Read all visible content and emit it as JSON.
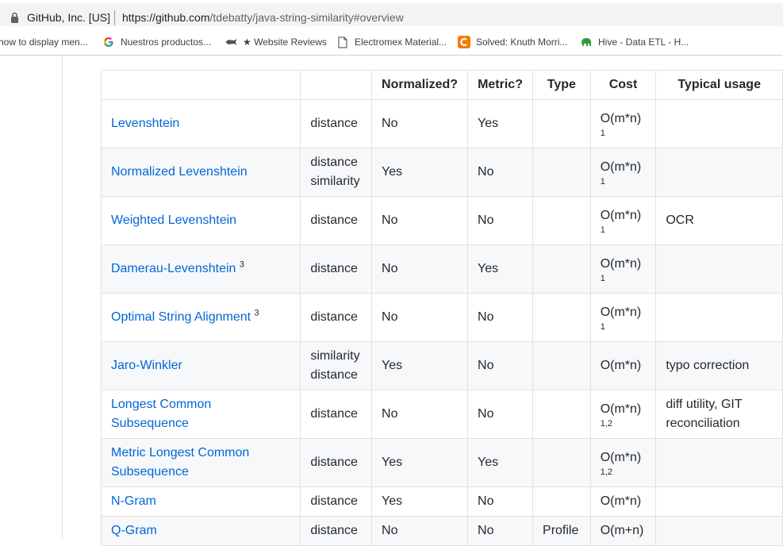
{
  "browser": {
    "site_name": "GitHub, Inc. [US]",
    "url_host": "https://github.com",
    "url_path": "/tdebatty/java-string-similarity#overview"
  },
  "bookmarks": [
    {
      "label": "how to display men...",
      "icon": "page-icon"
    },
    {
      "label": "Nuestros productos...",
      "icon": "google-icon"
    },
    {
      "label": "★ Website Reviews",
      "icon": "fish-icon"
    },
    {
      "label": "Electromex Material...",
      "icon": "document-icon"
    },
    {
      "label": "Solved: Knuth Morri...",
      "icon": "c-logo-icon"
    },
    {
      "label": "Hive - Data ETL - H...",
      "icon": "elephant-icon"
    }
  ],
  "colors": {
    "link": "#0366d6",
    "text": "#24292e",
    "border": "#dfe2e5",
    "stripe": "#f6f8fa"
  },
  "table": {
    "headers": [
      "",
      "",
      "Normalized?",
      "Metric?",
      "Type",
      "Cost",
      "Typical usage"
    ],
    "rows": [
      {
        "name": "Levenshtein",
        "sup": "",
        "kind": "distance",
        "normalized": "No",
        "metric": "Yes",
        "type": "",
        "cost": "O(m*n)",
        "cost_note": "1",
        "usage": ""
      },
      {
        "name": "Normalized Levenshtein",
        "sup": "",
        "kind": "distance similarity",
        "normalized": "Yes",
        "metric": "No",
        "type": "",
        "cost": "O(m*n)",
        "cost_note": "1",
        "usage": ""
      },
      {
        "name": "Weighted Levenshtein",
        "sup": "",
        "kind": "distance",
        "normalized": "No",
        "metric": "No",
        "type": "",
        "cost": "O(m*n)",
        "cost_note": "1",
        "usage": "OCR"
      },
      {
        "name": "Damerau-Levenshtein",
        "sup": "3",
        "kind": "distance",
        "normalized": "No",
        "metric": "Yes",
        "type": "",
        "cost": "O(m*n)",
        "cost_note": "1",
        "usage": ""
      },
      {
        "name": "Optimal String Alignment",
        "sup": "3",
        "kind": "distance",
        "normalized": "No",
        "metric": "No",
        "type": "",
        "cost": "O(m*n)",
        "cost_note": "1",
        "usage": ""
      },
      {
        "name": "Jaro-Winkler",
        "sup": "",
        "kind": "similarity distance",
        "normalized": "Yes",
        "metric": "No",
        "type": "",
        "cost": "O(m*n)",
        "cost_note": "",
        "usage": "typo correction"
      },
      {
        "name": "Longest Common Subsequence",
        "sup": "",
        "kind": "distance",
        "normalized": "No",
        "metric": "No",
        "type": "",
        "cost": "O(m*n)",
        "cost_note": "1,2",
        "usage": "diff utility, GIT reconciliation"
      },
      {
        "name": "Metric Longest Common Subsequence",
        "sup": "",
        "kind": "distance",
        "normalized": "Yes",
        "metric": "Yes",
        "type": "",
        "cost": "O(m*n)",
        "cost_note": "1,2",
        "usage": ""
      },
      {
        "name": "N-Gram",
        "sup": "",
        "kind": "distance",
        "normalized": "Yes",
        "metric": "No",
        "type": "",
        "cost": "O(m*n)",
        "cost_note": "",
        "usage": ""
      },
      {
        "name": "Q-Gram",
        "sup": "",
        "kind": "distance",
        "normalized": "No",
        "metric": "No",
        "type": "Profile",
        "cost": "O(m+n)",
        "cost_note": "",
        "usage": ""
      }
    ]
  }
}
